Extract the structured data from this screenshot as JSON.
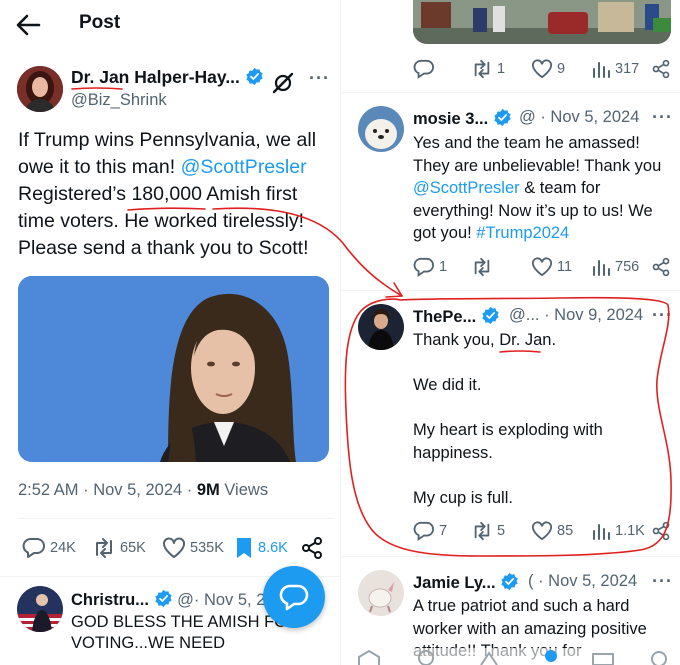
{
  "header": {
    "title": "Post"
  },
  "main_post": {
    "author": "Dr. Jan Halper-Hay...",
    "handle": "@Biz_Shrink",
    "text_parts": [
      "If Trump wins Pennsylvania, we all owe it to this man! ",
      "@ScottPresler",
      " Registered’s 180,000 Amish first time voters. He worked tirelessly! Please send a thank you to Scott!"
    ],
    "time": "2:52 AM · Nov 5, 2024 · ",
    "views_count": "9M",
    "views_label": " Views",
    "actions": {
      "replies": "24K",
      "reposts": "65K",
      "likes": "535K",
      "bookmarks": "8.6K"
    }
  },
  "left_reply": {
    "author": "Christru...",
    "meta": "@· Nov 5, 2",
    "text": "GOD BLESS THE AMISH FO VOTING...WE NEED"
  },
  "top_tweet_actions": {
    "reposts": "1",
    "likes": "9",
    "views": "317"
  },
  "replies": [
    {
      "author": "mosie 3...",
      "meta": "@ · Nov 5, 2024",
      "text_parts": [
        "Yes and the team he amassed! They are unbelievable!  Thank you ",
        "@ScottPresler",
        "  & team for everything! Now it’s up to us! We got you! ",
        "#Trump2024"
      ],
      "actions": {
        "replies": "1",
        "reposts": "",
        "likes": "11",
        "views": "756"
      }
    },
    {
      "author": "ThePe...",
      "meta": "@... · Nov 9, 2024",
      "text_lines": [
        "Thank you, Dr. Jan.",
        "",
        "We did it.",
        "",
        "My heart is exploding with happiness.",
        "",
        "My cup is full."
      ],
      "actions": {
        "replies": "7",
        "reposts": "5",
        "likes": "85",
        "views": "1.1K"
      }
    },
    {
      "author": "Jamie Ly...",
      "meta": "( · Nov 5, 2024",
      "text": "A true patriot and such a hard worker with an amazing positive attitude!! Thank you for"
    }
  ],
  "colors": {
    "accent": "#1d9bf0",
    "muted": "#536471",
    "annotation": "#e02020",
    "verified": "#1d9bf0"
  },
  "icons": [
    "back-arrow-icon",
    "verified-badge-icon",
    "grok-icon",
    "more-icon",
    "reply-icon",
    "repost-icon",
    "like-icon",
    "bookmark-icon",
    "views-icon",
    "share-icon",
    "compose-reply-icon"
  ]
}
